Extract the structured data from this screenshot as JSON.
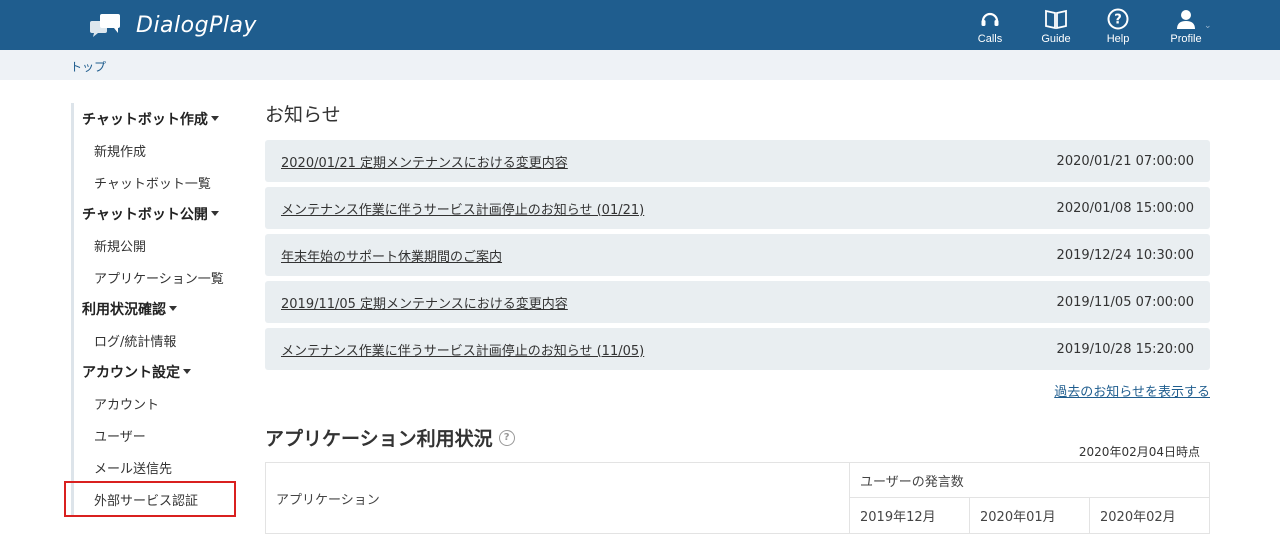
{
  "header": {
    "app_name": "DialogPlay",
    "nav": [
      {
        "label": "Calls",
        "icon": "headset-icon"
      },
      {
        "label": "Guide",
        "icon": "book-icon"
      },
      {
        "label": "Help",
        "icon": "question-icon"
      },
      {
        "label": "Profile",
        "icon": "user-icon"
      }
    ]
  },
  "breadcrumb": {
    "top": "トップ"
  },
  "sidebar": {
    "groups": [
      {
        "title": "チャットボット作成",
        "items": [
          "新規作成",
          "チャットボット一覧"
        ]
      },
      {
        "title": "チャットボット公開",
        "items": [
          "新規公開",
          "アプリケーション一覧"
        ]
      },
      {
        "title": "利用状況確認",
        "items": [
          "ログ/統計情報"
        ]
      },
      {
        "title": "アカウント設定",
        "items": [
          "アカウント",
          "ユーザー",
          "メール送信先",
          "外部サービス認証"
        ]
      }
    ]
  },
  "news": {
    "title": "お知らせ",
    "items": [
      {
        "text": "2020/01/21 定期メンテナンスにおける変更内容",
        "date": "2020/01/21 07:00:00"
      },
      {
        "text": "メンテナンス作業に伴うサービス計画停止のお知らせ (01/21)",
        "date": "2020/01/08 15:00:00"
      },
      {
        "text": "年末年始のサポート休業期間のご案内",
        "date": "2019/12/24 10:30:00"
      },
      {
        "text": "2019/11/05 定期メンテナンスにおける変更内容",
        "date": "2019/11/05 07:00:00"
      },
      {
        "text": "メンテナンス作業に伴うサービス計画停止のお知らせ (11/05)",
        "date": "2019/10/28 15:20:00"
      }
    ],
    "past_link": "過去のお知らせを表示する"
  },
  "usage": {
    "title": "アプリケーション利用状況",
    "as_of": "2020年02月04日時点",
    "table": {
      "app_header": "アプリケーション",
      "group_header": "ユーザーの発言数",
      "months": [
        "2019年12月",
        "2020年01月",
        "2020年02月"
      ]
    }
  },
  "colors": {
    "header_bg": "#1f5d8e",
    "highlight_border": "#d9201f",
    "news_row_bg": "#e9eef1"
  }
}
